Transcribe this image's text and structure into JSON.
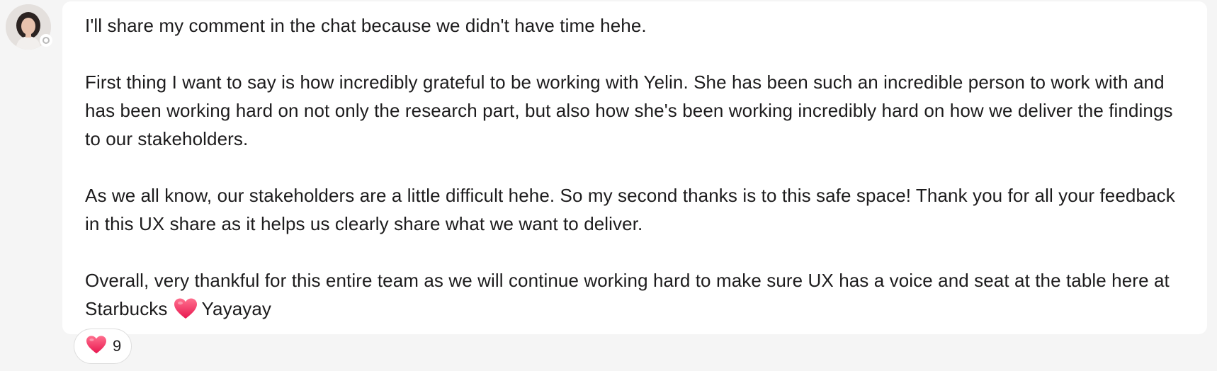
{
  "message": {
    "author_avatar_icon": "user-avatar",
    "presence_icon": "status-away-icon",
    "paragraphs": [
      "I'll share my comment in the chat because we didn't have time hehe.",
      "First thing I want to say is how incredibly grateful to be working with Yelin. She has been such an incredible person to work with and has been working hard on not only the research part, but also how she's been working incredibly hard on how we deliver the findings to our stakeholders.",
      "As we all know, our stakeholders are a little difficult hehe. So my second thanks is to this safe space! Thank you for all your feedback in this UX share as it helps us clearly share what we want to deliver.",
      "Overall, very thankful for this entire team as we will continue working hard to make sure UX has a voice and seat at the table here at Starbucks"
    ],
    "last_paragraph_suffix": "Yayayay",
    "inline_emoji_icon": "heart-icon"
  },
  "reactions": [
    {
      "emoji_icon": "heart-icon",
      "count": "9"
    }
  ],
  "colors": {
    "page_bg": "#f5f5f5",
    "bubble_bg": "#ffffff",
    "text": "#1d1c1d",
    "heart": "#f43b6b"
  }
}
